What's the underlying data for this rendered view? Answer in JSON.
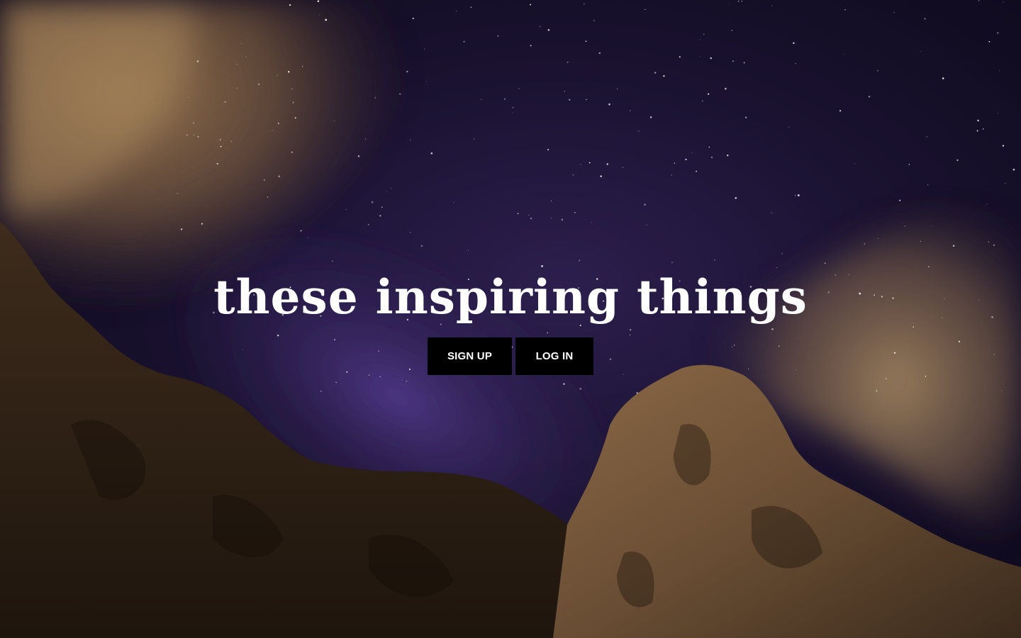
{
  "hero": {
    "title": "these inspiring things",
    "signup_label": "SIGN UP",
    "login_label": "LOG IN"
  },
  "background": {
    "image": "night-sky-mountains-photo",
    "colors": {
      "sky": "#120c22",
      "milky_way": "#3c2a6a",
      "cloud": "#8a6a46",
      "rock": "#3a2a1a",
      "rock_lit": "#7a5a3a"
    }
  },
  "colors": {
    "title_text": "#ffffff",
    "button_bg": "#000000",
    "button_text": "#ffffff"
  }
}
